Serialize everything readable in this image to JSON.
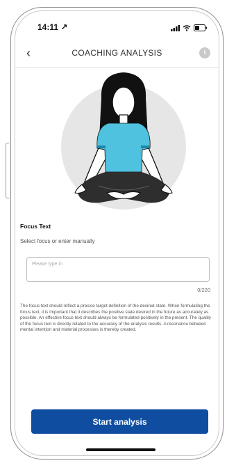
{
  "status": {
    "time": "14:11 ↗"
  },
  "header": {
    "back_glyph": "‹",
    "title": "COACHING ANALYSIS",
    "info_glyph": "i"
  },
  "focus": {
    "label": "Focus Text",
    "sublabel": "Select focus or enter manually",
    "placeholder": "Please type in",
    "value": "",
    "counter": "0/220"
  },
  "description": "The focus text should reflect a precise target definition of the desired state. When formulating the focus text, it is important that it describes the positive state desired in the future as accurately as possible. An effective focus text should always be formulated positively in the present. The quality of the focus text is directly related to the accuracy of the analysis results. A resonance between mental intention and material processes is thereby created.",
  "cta": {
    "label": "Start analysis"
  },
  "colors": {
    "primary": "#0e4da0",
    "shirt": "#4fc2df",
    "shirt_stripe": "#1d86a8",
    "hair": "#111111",
    "circle": "#e6e6e6"
  },
  "icons": [
    "chevron-left-icon",
    "info-icon",
    "signal-icon",
    "wifi-icon",
    "battery-icon"
  ]
}
